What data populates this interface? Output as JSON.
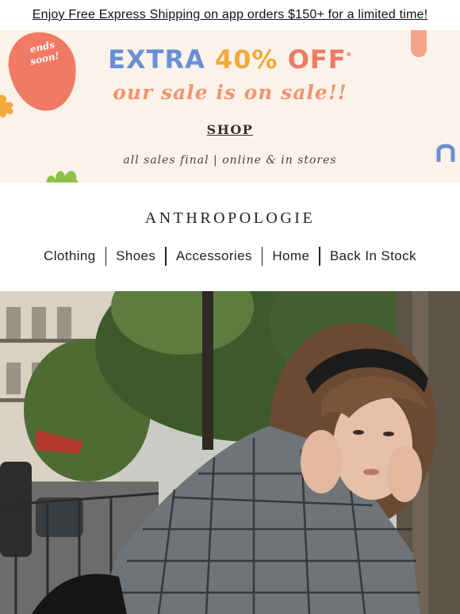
{
  "announcement": {
    "text": "Enjoy Free Express Shipping on app orders $150+ for a limited time!"
  },
  "promo": {
    "badge_line1": "ends",
    "badge_line2": "soon!",
    "headline_part1": "EXTRA",
    "headline_part2": "40%",
    "headline_part3": "OFF",
    "headline_mark": "*",
    "script_text": "our sale is on sale!!",
    "shop_label": "SHOP",
    "fine_print": "all sales final | online & in stores",
    "colors": {
      "background": "#fbf3ea",
      "blue": "#6a8fd6",
      "yellow": "#f2a93b",
      "coral": "#f07a63"
    }
  },
  "brand": {
    "logo_text": "ANTHROPOLOGIE"
  },
  "nav": {
    "items": [
      {
        "label": "Clothing"
      },
      {
        "label": "Shoes"
      },
      {
        "label": "Accessories"
      },
      {
        "label": "Home"
      },
      {
        "label": "Back In Stock"
      }
    ]
  },
  "hero": {
    "image": "woman-in-plaid-top-street-photo"
  }
}
